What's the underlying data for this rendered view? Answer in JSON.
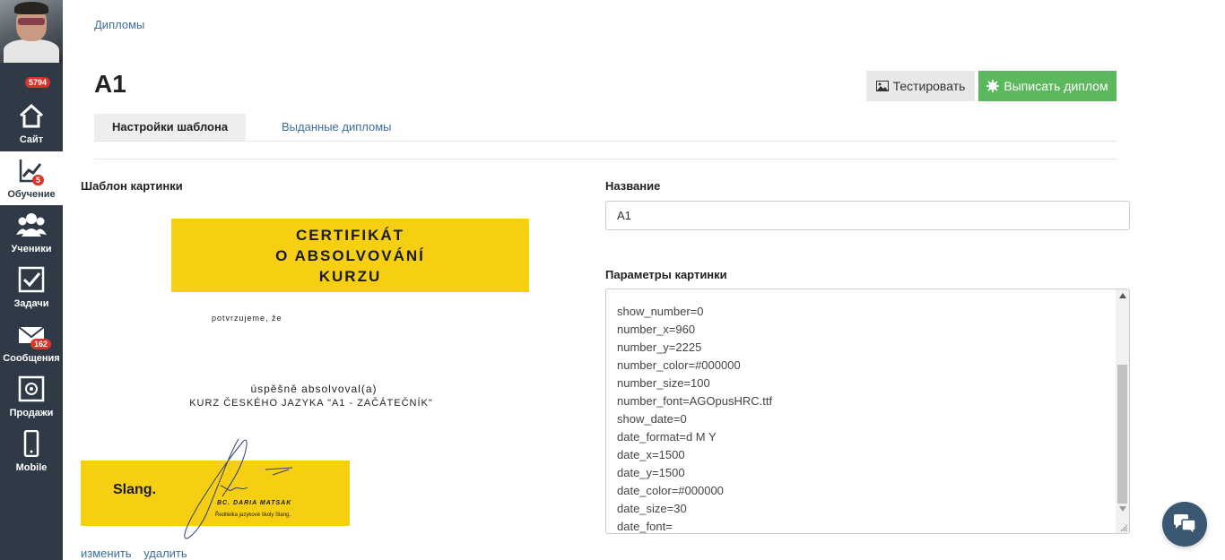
{
  "sidebar": {
    "top_badge": "5794",
    "items": [
      {
        "label": "Сайт",
        "badge": ""
      },
      {
        "label": "Обучение",
        "badge": "5"
      },
      {
        "label": "Ученики",
        "badge": ""
      },
      {
        "label": "Задачи",
        "badge": ""
      },
      {
        "label": "Сообщения",
        "badge": "162"
      },
      {
        "label": "Продажи",
        "badge": ""
      },
      {
        "label": "Mobile",
        "badge": ""
      }
    ]
  },
  "breadcrumb": "Дипломы",
  "page_title": "A1",
  "actions": {
    "test_label": "Тестировать",
    "issue_label": "Выписать диплом"
  },
  "tabs": [
    {
      "label": "Настройки шаблона",
      "active": true
    },
    {
      "label": "Выданные дипломы",
      "active": false
    }
  ],
  "template": {
    "label": "Шаблон картинки",
    "certificate": {
      "heading": [
        "CERTIFIKÁT",
        "O ABSOLVOVÁNÍ",
        "KURZU"
      ],
      "confirm_text": "potvrzujeme, že",
      "completed_text": "úspěšně absolvoval(a)",
      "course_text": "KURZ ČESKÉHO JAZYKA \"A1 - ZAČÁTEČNÍK\"",
      "logo": "Slang.",
      "signer_name": "BC. DARIA MATSAK",
      "signer_role": "Ředitelka jazykové školy Slang."
    },
    "links": {
      "edit": "изменить",
      "delete": "удалить"
    }
  },
  "form": {
    "name_label": "Название",
    "name_value": "A1",
    "params_label": "Параметры картинки",
    "params_lines": [
      "show_number=0",
      "number_x=960",
      "number_y=2225",
      "number_color=#000000",
      "number_size=100",
      "number_font=AGOpusHRC.ttf",
      "show_date=0",
      "date_format=d M Y",
      "date_x=1500",
      "date_y=1500",
      "date_color=#000000",
      "date_size=30",
      "date_font="
    ]
  },
  "colors": {
    "accent_green": "#5cb85c",
    "link_blue": "#3e6e9c",
    "sidebar": "#2f3a46",
    "certificate_yellow": "#f6cf13",
    "badge_red": "#d9342b"
  }
}
